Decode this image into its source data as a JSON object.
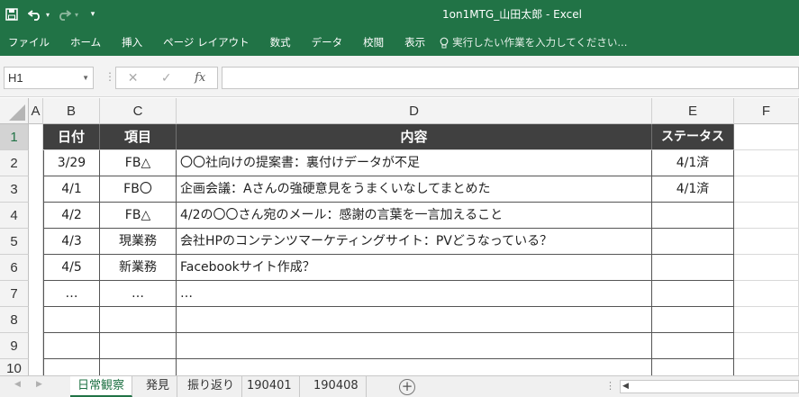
{
  "title_bar": {
    "title": "1on1MTG_山田太郎 - Excel",
    "save_icon": "save-icon",
    "undo_icon": "undo-icon",
    "redo_icon": "redo-icon",
    "customize_icon": "customize-qat-icon"
  },
  "ribbon": {
    "tabs": [
      "ファイル",
      "ホーム",
      "挿入",
      "ページ レイアウト",
      "数式",
      "データ",
      "校閲",
      "表示"
    ],
    "tell_me": "実行したい作業を入力してください..."
  },
  "formula_bar": {
    "name_box": "H1",
    "cancel": "✕",
    "enter": "✓",
    "fx": "fx",
    "formula": ""
  },
  "columns": [
    "A",
    "B",
    "C",
    "D",
    "E",
    "F"
  ],
  "rows": [
    "1",
    "2",
    "3",
    "4",
    "5",
    "6",
    "7",
    "8",
    "9",
    "10"
  ],
  "table": {
    "headers": [
      "日付",
      "項目",
      "内容",
      "ステータス"
    ],
    "rows": [
      [
        "3/29",
        "FB△",
        "〇〇社向けの提案書：裏付けデータが不足",
        "4/1済"
      ],
      [
        "4/1",
        "FB〇",
        "企画会議：Aさんの強硬意見をうまくいなしてまとめた",
        "4/1済"
      ],
      [
        "4/2",
        "FB△",
        "4/2の〇〇さん宛のメール：感謝の言葉を一言加えること",
        ""
      ],
      [
        "4/3",
        "現業務",
        "会社HPのコンテンツマーケティングサイト：PVどうなっている？",
        ""
      ],
      [
        "4/5",
        "新業務",
        "Facebookサイト作成？",
        ""
      ],
      [
        "…",
        "…",
        "…",
        ""
      ],
      [
        "",
        "",
        "",
        ""
      ],
      [
        "",
        "",
        "",
        ""
      ],
      [
        "",
        "",
        "",
        ""
      ]
    ]
  },
  "sheets": {
    "tabs": [
      "日常観察",
      "発見",
      "振り返り",
      "190401",
      "190408"
    ],
    "active": "日常観察"
  },
  "colors": {
    "excel_green": "#217346",
    "header_fill": "#404040"
  }
}
